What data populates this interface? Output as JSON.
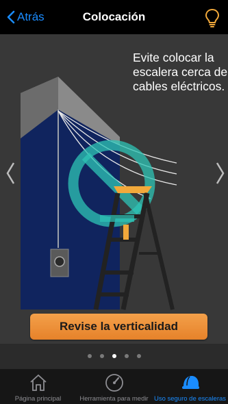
{
  "nav": {
    "back_label": "Atrás",
    "title": "Colocación",
    "tip_icon": "lightbulb-icon"
  },
  "slide": {
    "caption": "Evite colocar la escalera cerca de cables eléctricos.",
    "cta_label": "Revise la verticalidad",
    "page_count": 5,
    "current_page": 3
  },
  "tabs": [
    {
      "label": "Página principal",
      "icon": "home-icon",
      "active": false
    },
    {
      "label": "Herramienta para medir",
      "icon": "gauge-icon",
      "active": false
    },
    {
      "label": "Uso seguro de escaleras",
      "icon": "helmet-icon",
      "active": true
    }
  ],
  "colors": {
    "accent": "#1a8cff",
    "cta": "#e6822a",
    "warning_ring": "#2ec4b6",
    "ladder_top": "#f2a93b"
  }
}
